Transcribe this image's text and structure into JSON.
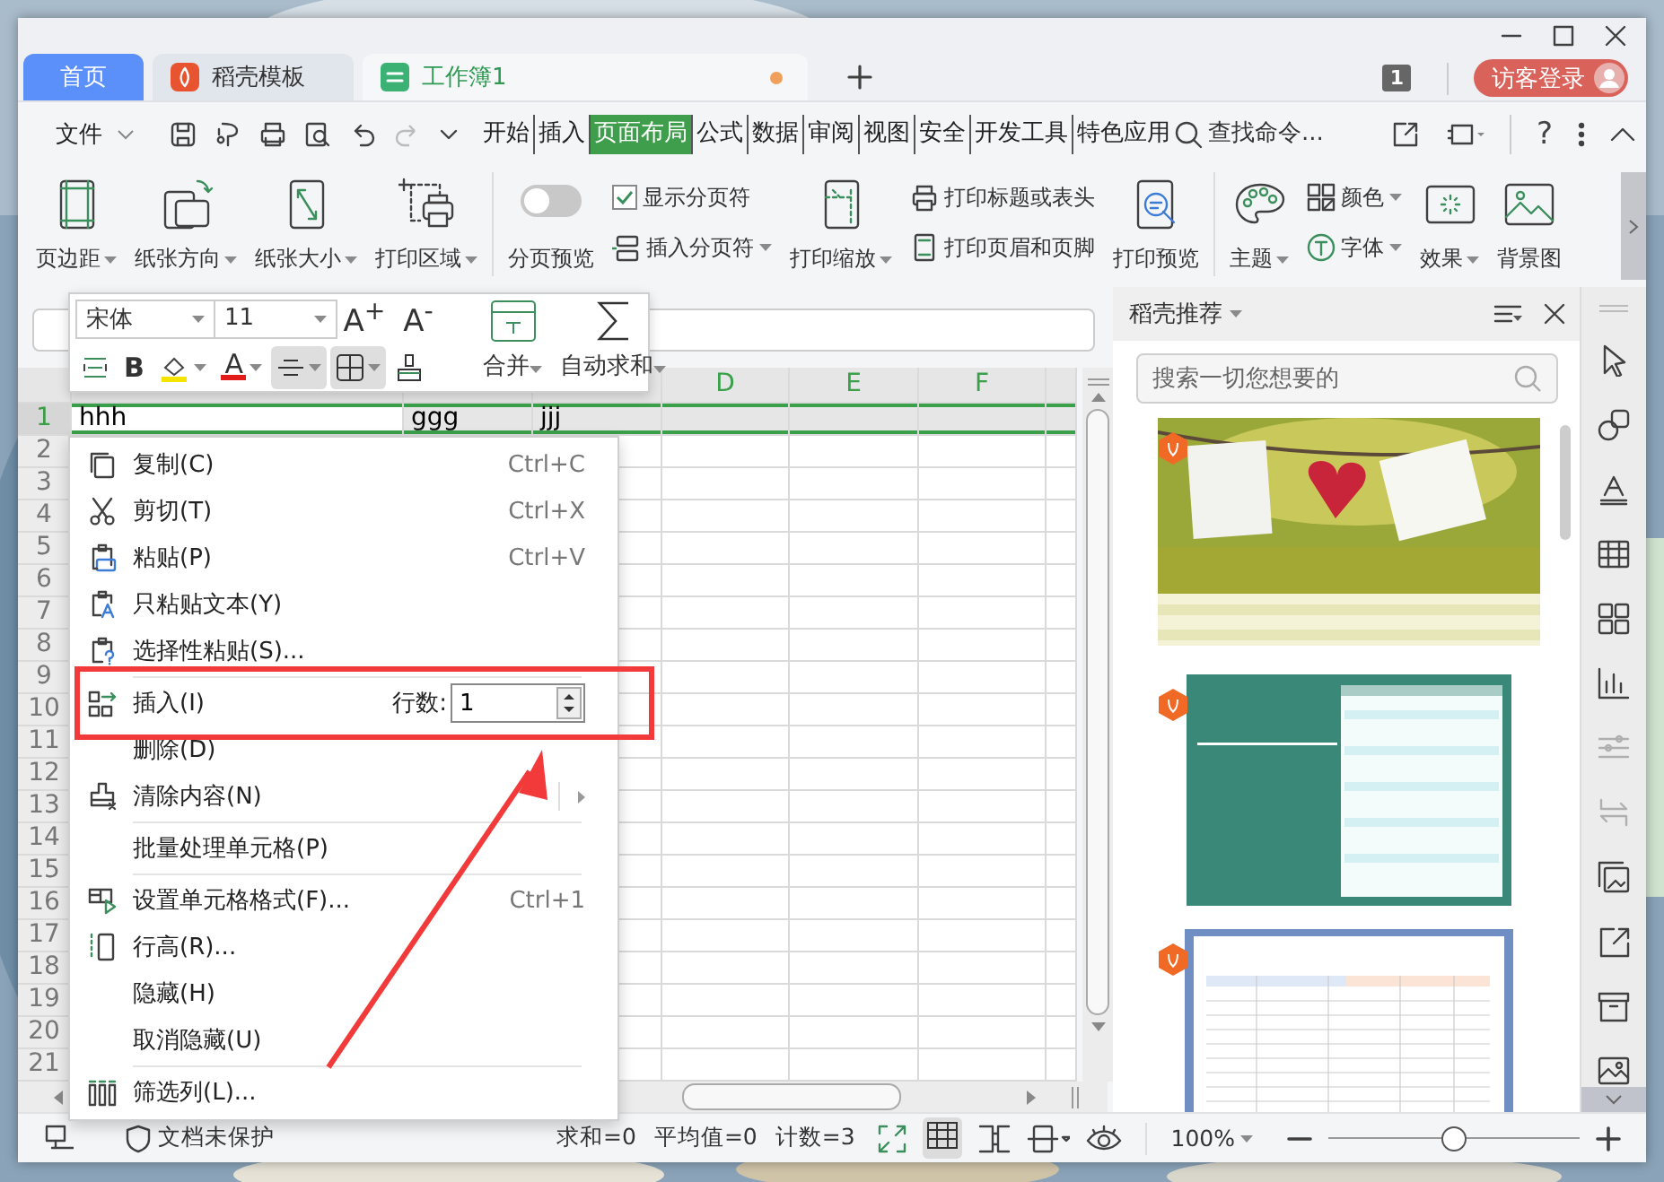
{
  "tabs": [
    {
      "label": "首页",
      "kind": "home",
      "selected": false
    },
    {
      "label": "稻壳模板",
      "kind": "docer",
      "selected": false
    },
    {
      "label": "工作簿1",
      "kind": "sheet",
      "selected": true,
      "unsaved": true
    }
  ],
  "doc_count": "1",
  "login_button": "访客登录",
  "file_menu": "文件",
  "menu_tabs": [
    {
      "label": "开始",
      "selected": false
    },
    {
      "label": "插入",
      "selected": false
    },
    {
      "label": "页面布局",
      "selected": true
    },
    {
      "label": "公式",
      "selected": false
    },
    {
      "label": "数据",
      "selected": false
    },
    {
      "label": "审阅",
      "selected": false
    },
    {
      "label": "视图",
      "selected": false
    },
    {
      "label": "安全",
      "selected": false
    },
    {
      "label": "开发工具",
      "selected": false
    },
    {
      "label": "特色应用",
      "selected": false
    }
  ],
  "command_search": {
    "placeholder": "查找命令..."
  },
  "help_button": "?",
  "ribbon": [
    [
      {
        "kind": "large",
        "label": "页边距",
        "dropdown": true
      },
      {
        "kind": "large",
        "label": "纸张方向",
        "dropdown": true
      },
      {
        "kind": "large",
        "label": "纸张大小",
        "dropdown": true
      },
      {
        "kind": "large",
        "label": "打印区域",
        "dropdown": true
      }
    ],
    [
      {
        "kind": "toggle",
        "label": "分页预览",
        "on": false
      },
      {
        "kind": "stack",
        "items": [
          {
            "kind": "checkbox",
            "label": "显示分页符",
            "checked": true
          },
          {
            "kind": "small",
            "label": "插入分页符",
            "dropdown": true
          }
        ]
      },
      {
        "kind": "large",
        "label": "打印缩放",
        "dropdown": true
      },
      {
        "kind": "stack",
        "items": [
          {
            "kind": "small",
            "label": "打印标题或表头",
            "dropdown": false
          },
          {
            "kind": "small",
            "label": "打印页眉和页脚",
            "dropdown": false
          }
        ]
      },
      {
        "kind": "large",
        "label": "打印预览",
        "dropdown": false
      }
    ],
    [
      {
        "kind": "large",
        "label": "主题",
        "dropdown": true
      },
      {
        "kind": "stack",
        "items": [
          {
            "kind": "small",
            "label": "颜色",
            "dropdown": true
          },
          {
            "kind": "small",
            "label": "字体",
            "dropdown": true
          }
        ]
      },
      {
        "kind": "large",
        "label": "效果",
        "dropdown": true
      },
      {
        "kind": "large",
        "label": "背景图",
        "dropdown": false
      }
    ]
  ],
  "mini_toolbar": {
    "font": "宋体",
    "size": "11",
    "size_buttons": [
      "A$^{+}$",
      "A$^{-}$"
    ],
    "tools": [
      {
        "kind": "wrap",
        "active": false
      },
      {
        "kind": "bold",
        "label": "B",
        "active": false
      },
      {
        "kind": "fill",
        "active": false
      },
      {
        "kind": "font_color",
        "label": "A",
        "active": false
      },
      {
        "kind": "align",
        "active": true
      },
      {
        "kind": "borders",
        "active": true
      },
      {
        "kind": "brush",
        "active": false
      }
    ],
    "merge": "合并",
    "autosum": "自动求和"
  },
  "sheet": {
    "columns": [
      "D",
      "E",
      "F"
    ],
    "rows": [
      {
        "number": "1",
        "cells": [
          "hhh",
          "ggg",
          "jjj"
        ],
        "selected": true
      },
      {
        "number": "2",
        "selected": false
      },
      {
        "number": "3",
        "selected": false
      },
      {
        "number": "4",
        "selected": false
      },
      {
        "number": "5",
        "selected": false
      },
      {
        "number": "6",
        "selected": false
      },
      {
        "number": "7",
        "selected": false
      },
      {
        "number": "8",
        "selected": false
      },
      {
        "number": "9",
        "selected": false
      },
      {
        "number": "10",
        "selected": false
      },
      {
        "number": "11",
        "selected": false
      },
      {
        "number": "12",
        "selected": false
      },
      {
        "number": "13",
        "selected": false
      },
      {
        "number": "14",
        "selected": false
      },
      {
        "number": "15",
        "selected": false
      },
      {
        "number": "16",
        "selected": false
      },
      {
        "number": "17",
        "selected": false
      },
      {
        "number": "18",
        "selected": false
      },
      {
        "number": "19",
        "selected": false
      },
      {
        "number": "20",
        "selected": false
      },
      {
        "number": "21",
        "selected": false
      }
    ]
  },
  "context_menu": {
    "groups": [
      [
        {
          "kind": "command",
          "label": "复制(C)",
          "shortcut": "Ctrl+C",
          "submenu": false
        },
        {
          "kind": "command",
          "label": "剪切(T)",
          "shortcut": "Ctrl+X",
          "submenu": false
        },
        {
          "kind": "command",
          "label": "粘贴(P)",
          "shortcut": "Ctrl+V",
          "submenu": false
        },
        {
          "kind": "command",
          "label": "只粘贴文本(Y)",
          "submenu": false
        },
        {
          "kind": "command",
          "label": "选择性粘贴(S)...",
          "submenu": false
        }
      ],
      [
        {
          "kind": "insert",
          "label": "插入(I)",
          "count_label": "行数:",
          "count": "1"
        },
        {
          "kind": "command",
          "label": "删除(D)",
          "submenu": false
        },
        {
          "kind": "command",
          "label": "清除内容(N)",
          "submenu": true
        }
      ],
      [
        {
          "kind": "command",
          "label": "批量处理单元格(P)",
          "submenu": false
        }
      ],
      [
        {
          "kind": "command",
          "label": "设置单元格格式(F)...",
          "shortcut": "Ctrl+1",
          "submenu": false
        },
        {
          "kind": "command",
          "label": "行高(R)...",
          "submenu": false
        },
        {
          "kind": "command",
          "label": "隐藏(H)",
          "submenu": false
        },
        {
          "kind": "command",
          "label": "取消隐藏(U)",
          "submenu": false
        }
      ],
      [
        {
          "kind": "command",
          "label": "筛选列(L)...",
          "submenu": false
        }
      ]
    ]
  },
  "side_pane": {
    "title": "稻壳推荐",
    "search": {
      "placeholder": "搜索一切您想要的"
    }
  },
  "status_bar": {
    "protection": "文档未保护",
    "sum": "求和=0",
    "average": "平均值=0",
    "count": "计数=3",
    "zoom": "100%",
    "zoom_slider": {
      "level": 0.5
    }
  }
}
